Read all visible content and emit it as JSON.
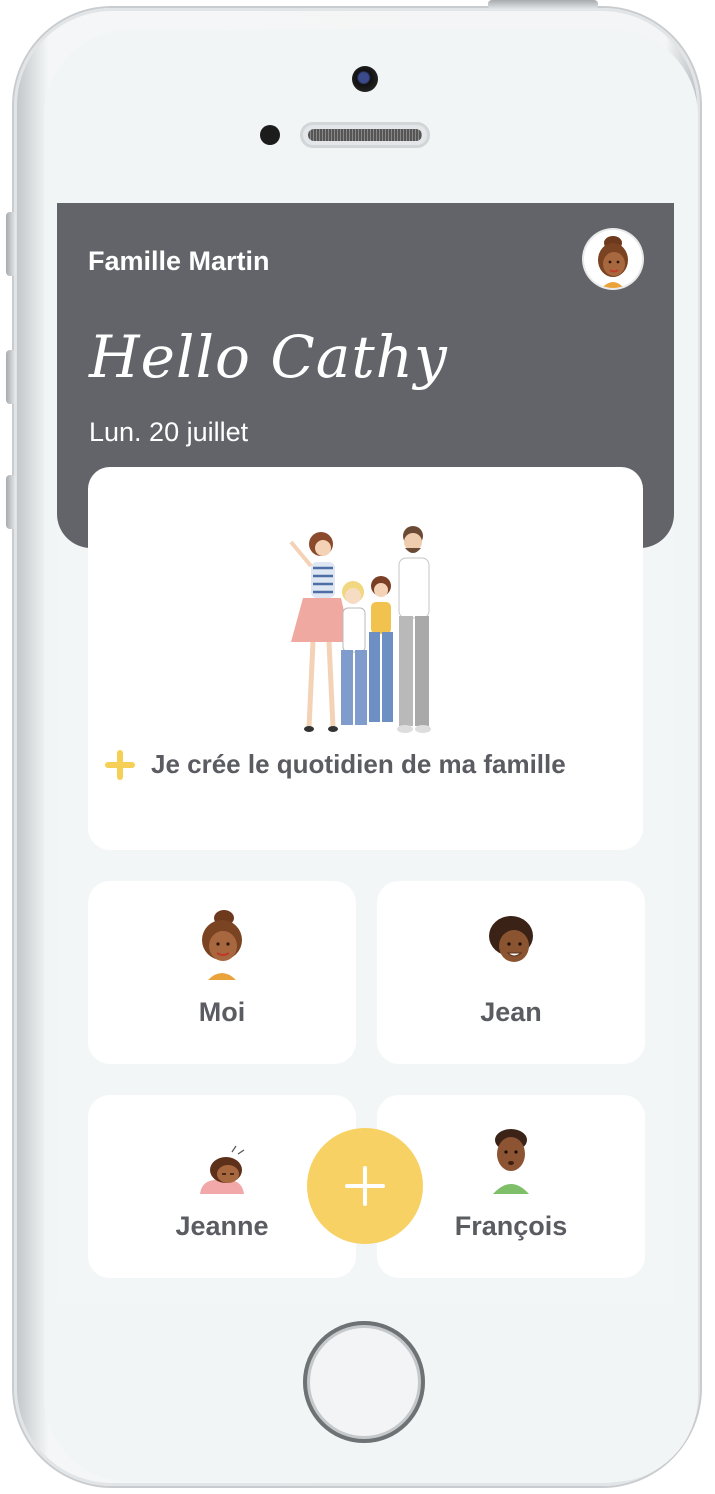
{
  "header": {
    "family_name": "Famille Martin",
    "greeting": "Hello Cathy",
    "date": "Lun. 20 juillet"
  },
  "main_card": {
    "create_label": "Je crée le quotidien de ma famille"
  },
  "members": [
    {
      "name": "Moi"
    },
    {
      "name": "Jean"
    },
    {
      "name": "Jeanne"
    },
    {
      "name": "François"
    }
  ],
  "colors": {
    "header_bg": "#626469",
    "accent_yellow": "#f7d163",
    "text_dark": "#5b5c62",
    "screen_bg": "#f3f6f7"
  },
  "icons": {
    "add_small": "plus-icon",
    "fab": "plus-icon"
  }
}
